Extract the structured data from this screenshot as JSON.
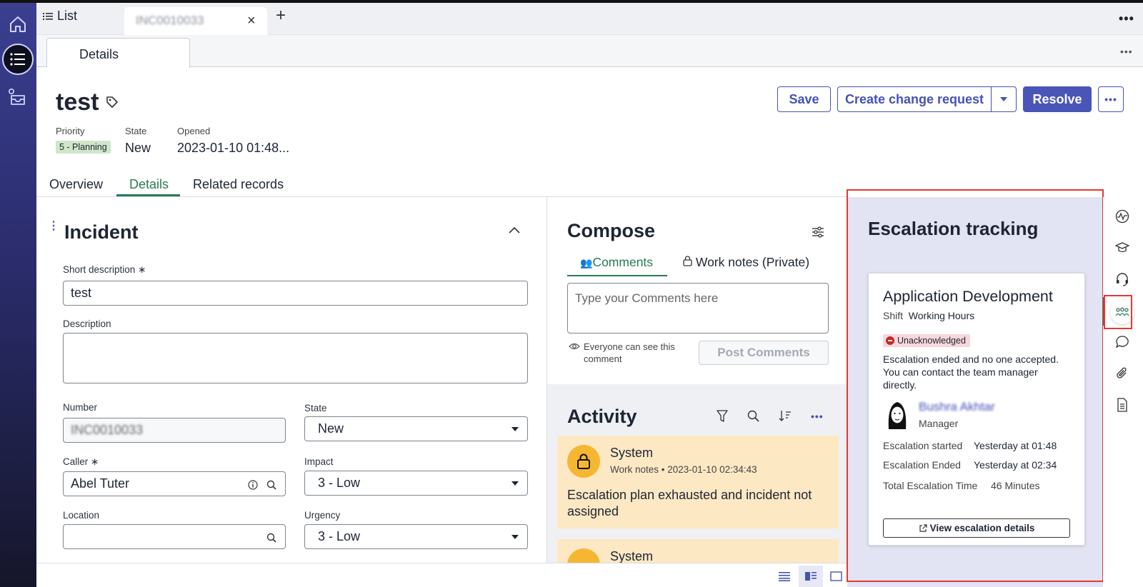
{
  "app": {
    "tabs": [
      {
        "label": "List",
        "icon": "list-icon"
      },
      {
        "label": "INC0010033"
      }
    ],
    "subtab": "Details"
  },
  "record": {
    "title": "test",
    "meta": {
      "priority_label": "Priority",
      "priority_value": "5 - Planning",
      "state_label": "State",
      "state_value": "New",
      "opened_label": "Opened",
      "opened_value": "2023-01-10 01:48..."
    },
    "buttons": {
      "save": "Save",
      "create_change": "Create change request",
      "resolve": "Resolve"
    },
    "tabs": [
      "Overview",
      "Details",
      "Related records"
    ],
    "active_tab": "Details"
  },
  "form": {
    "section_title": "Incident",
    "short_description_label": "Short description",
    "short_description_value": "test",
    "description_label": "Description",
    "description_value": "",
    "number_label": "Number",
    "number_value": "INC0010033",
    "state_label": "State",
    "state_value": "New",
    "caller_label": "Caller",
    "caller_value": "Abel Tuter",
    "impact_label": "Impact",
    "impact_value": "3 - Low",
    "location_label": "Location",
    "location_value": "",
    "urgency_label": "Urgency",
    "urgency_value": "3 - Low",
    "required_mark": "∗"
  },
  "compose": {
    "title": "Compose",
    "tab_comments": "Comments",
    "tab_worknotes": "Work notes (Private)",
    "placeholder": "Type your Comments here",
    "visibility_note_1": "Everyone can see this",
    "visibility_note_2": "comment",
    "post_button": "Post Comments"
  },
  "activity": {
    "title": "Activity",
    "entries": [
      {
        "author": "System",
        "type": "Work notes",
        "timestamp": "2023-01-10 02:34:43",
        "text_1": "Escalation plan exhausted and incident not",
        "text_2": "assigned"
      },
      {
        "author": "System"
      }
    ]
  },
  "escalation": {
    "title": "Escalation tracking",
    "group": "Application Development",
    "shift_label": "Shift",
    "shift_value": "Working Hours",
    "status": "Unacknowledged",
    "message_1": "Escalation ended and no one accepted.",
    "message_2": "You can contact the team manager",
    "message_3": "directly.",
    "manager_name": "Bushra Akhtar",
    "manager_role": "Manager",
    "started_label": "Escalation started",
    "started_value": "Yesterday at 01:48",
    "ended_label": "Escalation Ended",
    "ended_value": "Yesterday at 02:34",
    "total_label": "Total Escalation Time",
    "total_value": "46 Minutes",
    "view_button": "View escalation details"
  },
  "colors": {
    "accent": "#4a55b8",
    "green": "#2b7a55",
    "escalation_bg": "#e2e3f3",
    "activity_bg": "#fde8c4",
    "highlight": "#e53935"
  }
}
